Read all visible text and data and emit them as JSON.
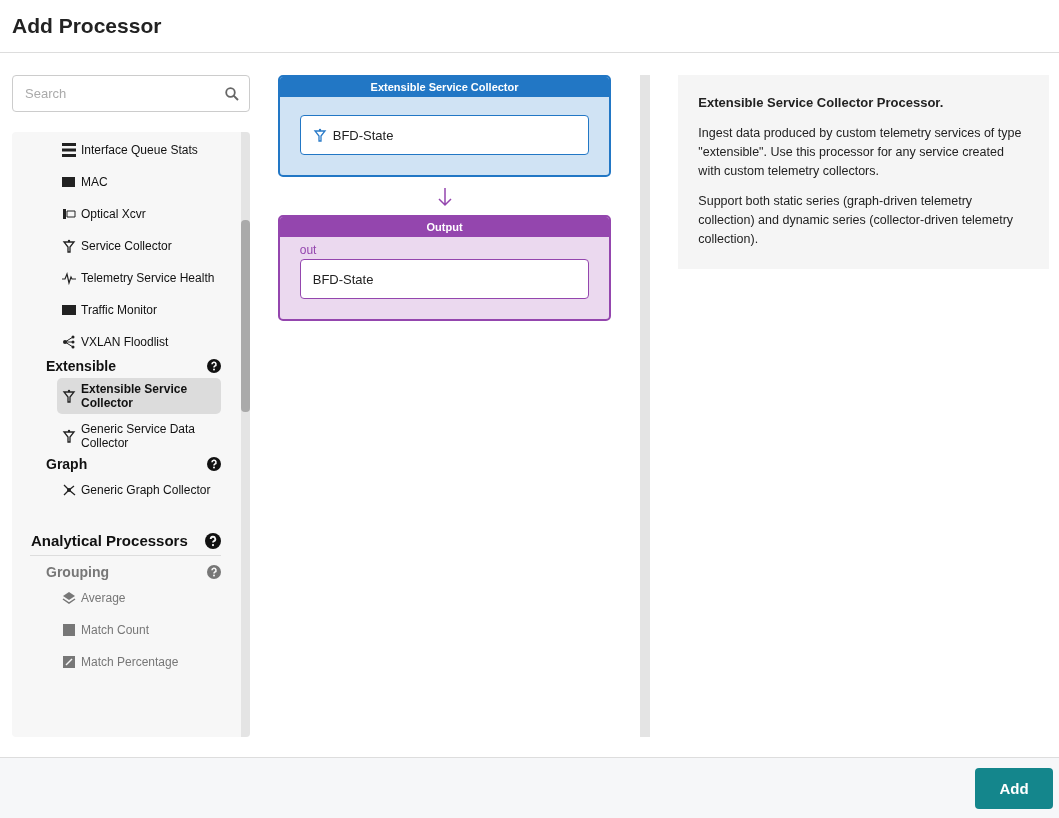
{
  "header": {
    "title": "Add Processor"
  },
  "search": {
    "placeholder": "Search"
  },
  "sidebar": {
    "items": [
      {
        "kind": "item",
        "label": "Interface Queue Stats",
        "selected": false,
        "disabled": false
      },
      {
        "kind": "item",
        "label": "MAC",
        "selected": false,
        "disabled": false
      },
      {
        "kind": "item",
        "label": "Optical Xcvr",
        "selected": false,
        "disabled": false
      },
      {
        "kind": "item",
        "label": "Service Collector",
        "selected": false,
        "disabled": false
      },
      {
        "kind": "item",
        "label": "Telemetry Service Health",
        "selected": false,
        "disabled": false
      },
      {
        "kind": "item",
        "label": "Traffic Monitor",
        "selected": false,
        "disabled": false
      },
      {
        "kind": "item",
        "label": "VXLAN Floodlist",
        "selected": false,
        "disabled": false
      },
      {
        "kind": "group",
        "label": "Extensible",
        "disabled": false
      },
      {
        "kind": "item",
        "label": "Extensible Service Collector",
        "selected": true,
        "disabled": false
      },
      {
        "kind": "item",
        "label": "Generic Service Data Collector",
        "selected": false,
        "disabled": false
      },
      {
        "kind": "group",
        "label": "Graph",
        "disabled": false
      },
      {
        "kind": "item",
        "label": "Generic Graph Collector",
        "selected": false,
        "disabled": false
      },
      {
        "kind": "section",
        "label": "Analytical Processors",
        "disabled": false
      },
      {
        "kind": "group",
        "label": "Grouping",
        "disabled": true
      },
      {
        "kind": "item",
        "label": "Average",
        "selected": false,
        "disabled": true
      },
      {
        "kind": "item",
        "label": "Match Count",
        "selected": false,
        "disabled": true
      },
      {
        "kind": "item",
        "label": "Match Percentage",
        "selected": false,
        "disabled": true
      }
    ]
  },
  "canvas": {
    "processor": {
      "title": "Extensible Service Collector",
      "value": "BFD-State"
    },
    "output": {
      "title": "Output",
      "port_label": "out",
      "value": "BFD-State"
    }
  },
  "info": {
    "title": "Extensible Service Collector Processor.",
    "paragraphs": [
      "Ingest data produced by custom telemetry services of type \"extensible\". Use this processor for any service created with custom telemetry collectors.",
      "Support both static series (graph-driven telemetry collection) and dynamic series (collector-driven telemetry collection)."
    ]
  },
  "footer": {
    "button": "Add"
  }
}
